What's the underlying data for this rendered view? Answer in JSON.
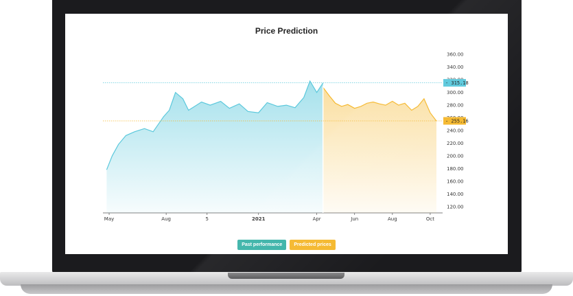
{
  "chart_data": {
    "type": "area",
    "title": "Price Prediction",
    "ylim": [
      110,
      370
    ],
    "y_ticks": [
      "360.00",
      "340.00",
      "320.00",
      "300.00",
      "280.00",
      "260.00",
      "240.00",
      "220.00",
      "200.00",
      "180.00",
      "160.00",
      "140.00",
      "120.00"
    ],
    "x_ticks": [
      "May",
      "Aug",
      "5",
      "2021",
      "Apr",
      "Jun",
      "Aug",
      "Oct"
    ],
    "series": [
      {
        "name": "Past performance",
        "color": "#5bc8dc",
        "x": [
          "2020-05-01",
          "2020-05-10",
          "2020-05-20",
          "2020-06-01",
          "2020-06-15",
          "2020-07-01",
          "2020-07-15",
          "2020-08-01",
          "2020-08-10",
          "2020-08-20",
          "2020-09-01",
          "2020-09-10",
          "2020-09-20",
          "2020-10-01",
          "2020-10-15",
          "2020-11-01",
          "2020-11-15",
          "2020-12-01",
          "2020-12-15",
          "2021-01-01",
          "2021-01-15",
          "2021-02-01",
          "2021-02-15",
          "2021-03-01",
          "2021-03-15",
          "2021-03-25",
          "2021-04-05",
          "2021-04-15"
        ],
        "values": [
          178,
          200,
          218,
          232,
          238,
          243,
          238,
          262,
          272,
          300,
          290,
          272,
          278,
          285,
          280,
          286,
          275,
          282,
          270,
          268,
          284,
          278,
          280,
          276,
          292,
          318,
          300,
          315
        ]
      },
      {
        "name": "Predicted prices",
        "color": "#f5b82e",
        "x": [
          "2021-04-15",
          "2021-04-25",
          "2021-05-05",
          "2021-05-15",
          "2021-05-25",
          "2021-06-05",
          "2021-06-15",
          "2021-06-25",
          "2021-07-05",
          "2021-07-15",
          "2021-07-25",
          "2021-08-05",
          "2021-08-15",
          "2021-08-25",
          "2021-09-05",
          "2021-09-15",
          "2021-09-25",
          "2021-10-05",
          "2021-10-15"
        ],
        "values": [
          308,
          295,
          283,
          278,
          281,
          275,
          278,
          283,
          285,
          282,
          280,
          286,
          280,
          283,
          272,
          278,
          290,
          268,
          255
        ]
      }
    ],
    "price_tags": [
      {
        "label": "315.18",
        "value": 315.18,
        "color": "#5bc8dc"
      },
      {
        "label": "255.16",
        "value": 255.16,
        "color": "#f5b82e"
      }
    ],
    "legend": "bottom-center",
    "grid": false
  }
}
